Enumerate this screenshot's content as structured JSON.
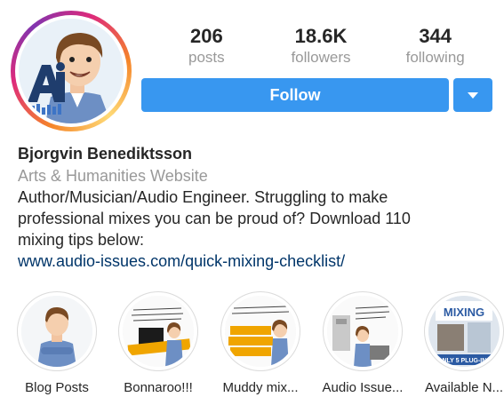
{
  "profile": {
    "stats": [
      {
        "value": "206",
        "label": "posts"
      },
      {
        "value": "18.6K",
        "label": "followers"
      },
      {
        "value": "344",
        "label": "following"
      }
    ],
    "follow_label": "Follow",
    "avatar_icon": "cartoon-avatar-with-ai-logo",
    "dropdown_icon": "chevron-down-icon"
  },
  "bio": {
    "name": "Bjorgvin Benediktsson",
    "category": "Arts & Humanities Website",
    "lines": [
      "Author/Musician/Audio Engineer. Struggling to make",
      "professional mixes you can be proud of? Download 110",
      "mixing tips below:"
    ],
    "link": "www.audio-issues.com/quick-mixing-checklist/"
  },
  "highlights": [
    {
      "label": "Blog Posts"
    },
    {
      "label": "Bonnaroo!!!",
      "badge": "Swipe up"
    },
    {
      "label": "Muddy mix...",
      "caption": "muddy mixes"
    },
    {
      "label": "Audio Issue..."
    },
    {
      "label": "Available N...",
      "sign_top": "MIXING",
      "sign_bottom": "ONLY 5 PLUG-INS"
    }
  ],
  "colors": {
    "accent": "#3897f0",
    "muted": "#999999",
    "link": "#003569",
    "text": "#262626"
  }
}
